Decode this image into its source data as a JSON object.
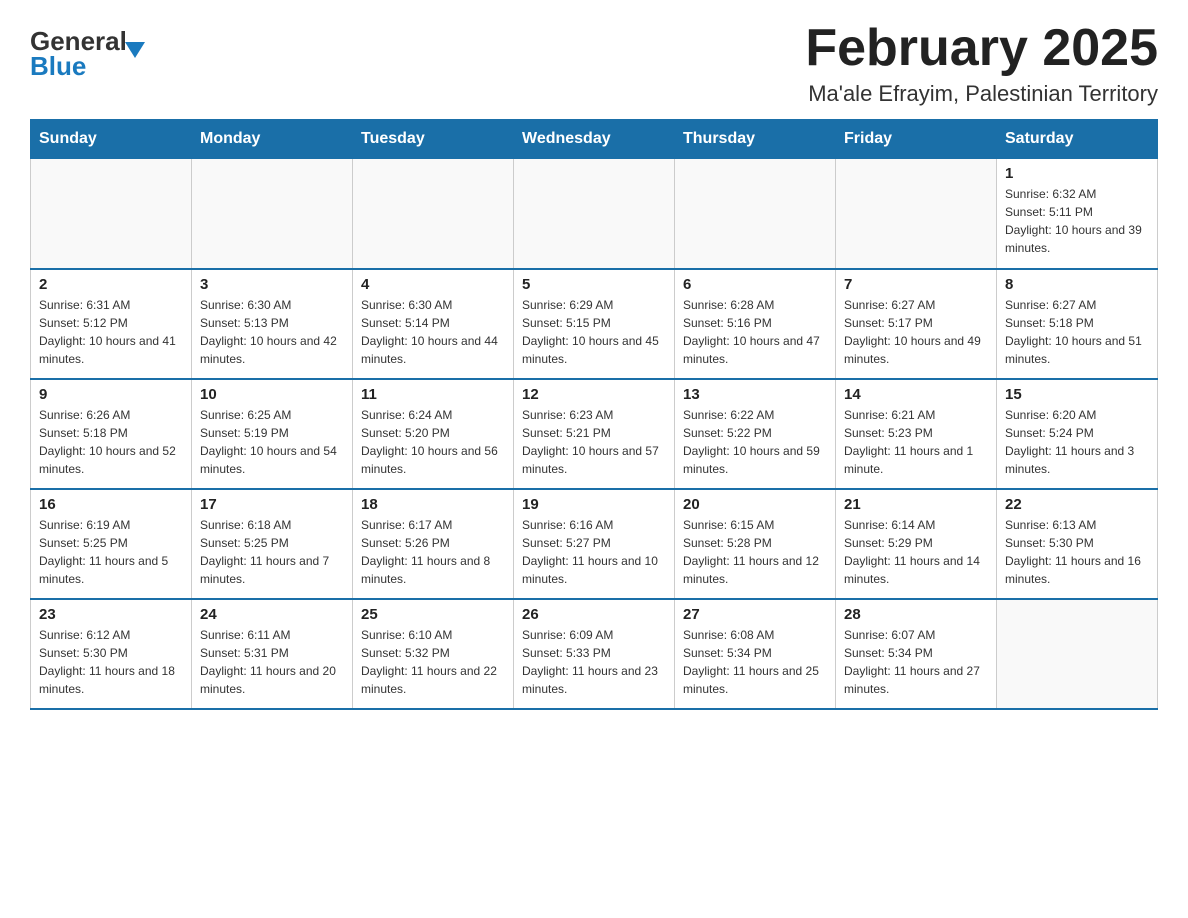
{
  "header": {
    "logo_general": "General",
    "logo_blue": "Blue",
    "title": "February 2025",
    "subtitle": "Ma'ale Efrayim, Palestinian Territory"
  },
  "days_of_week": [
    "Sunday",
    "Monday",
    "Tuesday",
    "Wednesday",
    "Thursday",
    "Friday",
    "Saturday"
  ],
  "weeks": [
    [
      {
        "day": "",
        "info": ""
      },
      {
        "day": "",
        "info": ""
      },
      {
        "day": "",
        "info": ""
      },
      {
        "day": "",
        "info": ""
      },
      {
        "day": "",
        "info": ""
      },
      {
        "day": "",
        "info": ""
      },
      {
        "day": "1",
        "info": "Sunrise: 6:32 AM\nSunset: 5:11 PM\nDaylight: 10 hours and 39 minutes."
      }
    ],
    [
      {
        "day": "2",
        "info": "Sunrise: 6:31 AM\nSunset: 5:12 PM\nDaylight: 10 hours and 41 minutes."
      },
      {
        "day": "3",
        "info": "Sunrise: 6:30 AM\nSunset: 5:13 PM\nDaylight: 10 hours and 42 minutes."
      },
      {
        "day": "4",
        "info": "Sunrise: 6:30 AM\nSunset: 5:14 PM\nDaylight: 10 hours and 44 minutes."
      },
      {
        "day": "5",
        "info": "Sunrise: 6:29 AM\nSunset: 5:15 PM\nDaylight: 10 hours and 45 minutes."
      },
      {
        "day": "6",
        "info": "Sunrise: 6:28 AM\nSunset: 5:16 PM\nDaylight: 10 hours and 47 minutes."
      },
      {
        "day": "7",
        "info": "Sunrise: 6:27 AM\nSunset: 5:17 PM\nDaylight: 10 hours and 49 minutes."
      },
      {
        "day": "8",
        "info": "Sunrise: 6:27 AM\nSunset: 5:18 PM\nDaylight: 10 hours and 51 minutes."
      }
    ],
    [
      {
        "day": "9",
        "info": "Sunrise: 6:26 AM\nSunset: 5:18 PM\nDaylight: 10 hours and 52 minutes."
      },
      {
        "day": "10",
        "info": "Sunrise: 6:25 AM\nSunset: 5:19 PM\nDaylight: 10 hours and 54 minutes."
      },
      {
        "day": "11",
        "info": "Sunrise: 6:24 AM\nSunset: 5:20 PM\nDaylight: 10 hours and 56 minutes."
      },
      {
        "day": "12",
        "info": "Sunrise: 6:23 AM\nSunset: 5:21 PM\nDaylight: 10 hours and 57 minutes."
      },
      {
        "day": "13",
        "info": "Sunrise: 6:22 AM\nSunset: 5:22 PM\nDaylight: 10 hours and 59 minutes."
      },
      {
        "day": "14",
        "info": "Sunrise: 6:21 AM\nSunset: 5:23 PM\nDaylight: 11 hours and 1 minute."
      },
      {
        "day": "15",
        "info": "Sunrise: 6:20 AM\nSunset: 5:24 PM\nDaylight: 11 hours and 3 minutes."
      }
    ],
    [
      {
        "day": "16",
        "info": "Sunrise: 6:19 AM\nSunset: 5:25 PM\nDaylight: 11 hours and 5 minutes."
      },
      {
        "day": "17",
        "info": "Sunrise: 6:18 AM\nSunset: 5:25 PM\nDaylight: 11 hours and 7 minutes."
      },
      {
        "day": "18",
        "info": "Sunrise: 6:17 AM\nSunset: 5:26 PM\nDaylight: 11 hours and 8 minutes."
      },
      {
        "day": "19",
        "info": "Sunrise: 6:16 AM\nSunset: 5:27 PM\nDaylight: 11 hours and 10 minutes."
      },
      {
        "day": "20",
        "info": "Sunrise: 6:15 AM\nSunset: 5:28 PM\nDaylight: 11 hours and 12 minutes."
      },
      {
        "day": "21",
        "info": "Sunrise: 6:14 AM\nSunset: 5:29 PM\nDaylight: 11 hours and 14 minutes."
      },
      {
        "day": "22",
        "info": "Sunrise: 6:13 AM\nSunset: 5:30 PM\nDaylight: 11 hours and 16 minutes."
      }
    ],
    [
      {
        "day": "23",
        "info": "Sunrise: 6:12 AM\nSunset: 5:30 PM\nDaylight: 11 hours and 18 minutes."
      },
      {
        "day": "24",
        "info": "Sunrise: 6:11 AM\nSunset: 5:31 PM\nDaylight: 11 hours and 20 minutes."
      },
      {
        "day": "25",
        "info": "Sunrise: 6:10 AM\nSunset: 5:32 PM\nDaylight: 11 hours and 22 minutes."
      },
      {
        "day": "26",
        "info": "Sunrise: 6:09 AM\nSunset: 5:33 PM\nDaylight: 11 hours and 23 minutes."
      },
      {
        "day": "27",
        "info": "Sunrise: 6:08 AM\nSunset: 5:34 PM\nDaylight: 11 hours and 25 minutes."
      },
      {
        "day": "28",
        "info": "Sunrise: 6:07 AM\nSunset: 5:34 PM\nDaylight: 11 hours and 27 minutes."
      },
      {
        "day": "",
        "info": ""
      }
    ]
  ]
}
